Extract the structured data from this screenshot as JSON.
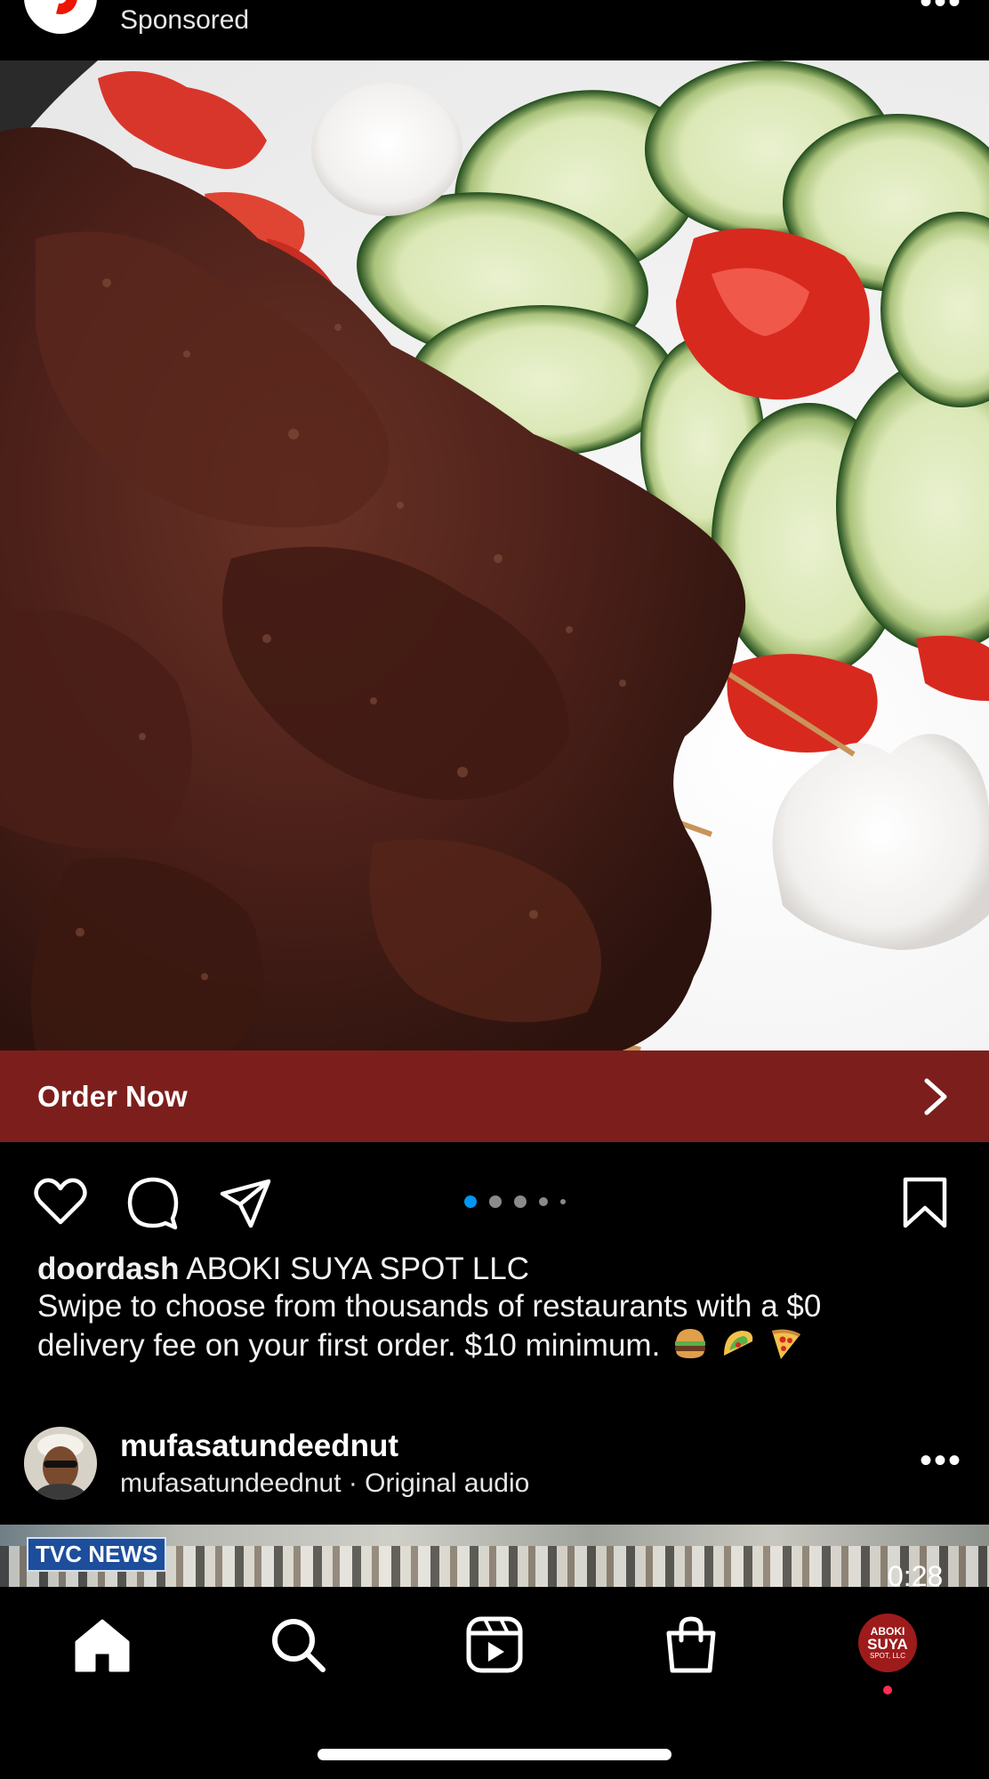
{
  "sponsored_post": {
    "label": "Sponsored",
    "more_icon": "more-horizontal-icon",
    "cta_label": "Order Now",
    "cta_color": "#7c1f1c",
    "carousel": {
      "total": 5,
      "active": 1,
      "active_color": "#0095f6"
    },
    "caption": {
      "username": "doordash",
      "headline": "ABOKI SUYA SPOT LLC",
      "line1": "Swipe to choose from thousands of restaurants with a $0",
      "line2": "delivery fee on your first order. $10 minimum."
    }
  },
  "next_post": {
    "username": "mufasatundeednut",
    "subtitle": "mufasatundeednut · Original audio",
    "video_overlay_text": "TVC NEWS",
    "video_time": "0:28"
  },
  "bottom_nav": {
    "items": [
      "home-icon",
      "search-icon",
      "reels-icon",
      "shop-icon",
      "profile-avatar"
    ],
    "profile_badge": {
      "line1": "ABOKI",
      "line2": "SUYA",
      "line3": "SPOT, LLC"
    },
    "notification_color": "#ff2d55"
  }
}
